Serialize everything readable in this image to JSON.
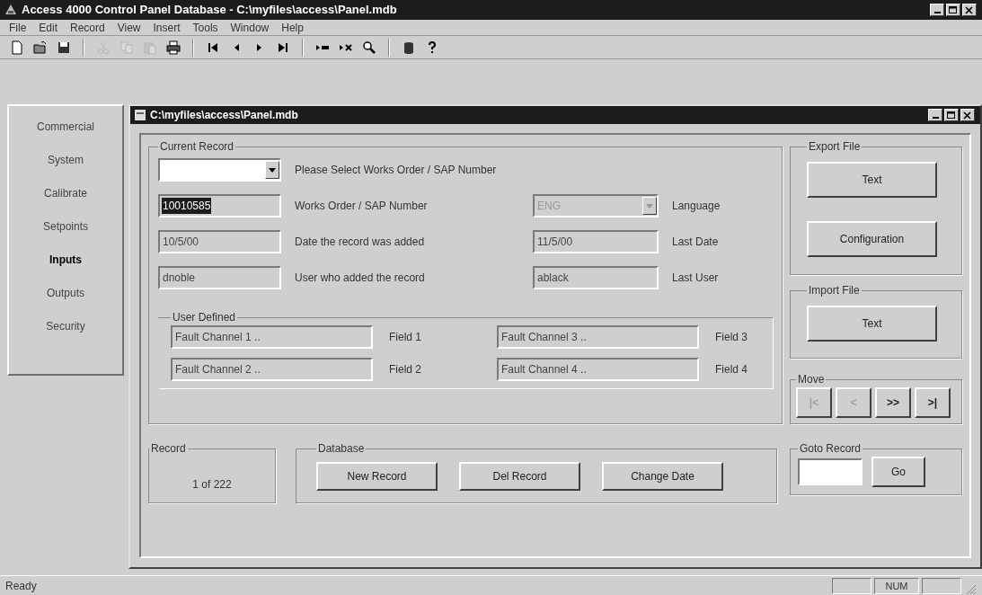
{
  "window": {
    "title": "Access 4000 Control Panel Database - C:\\myfiles\\access\\Panel.mdb"
  },
  "menu": [
    "File",
    "Edit",
    "Record",
    "View",
    "Insert",
    "Tools",
    "Window",
    "Help"
  ],
  "toolbar": [
    {
      "kind": "new",
      "disabled": false
    },
    {
      "kind": "open",
      "disabled": false
    },
    {
      "kind": "save",
      "disabled": false
    },
    {
      "kind": "separator"
    },
    {
      "kind": "cut",
      "disabled": true
    },
    {
      "kind": "copy",
      "disabled": true
    },
    {
      "kind": "paste",
      "disabled": true
    },
    {
      "kind": "print",
      "disabled": false
    },
    {
      "kind": "separator"
    },
    {
      "kind": "first",
      "disabled": false
    },
    {
      "kind": "prev",
      "disabled": false
    },
    {
      "kind": "next",
      "disabled": false
    },
    {
      "kind": "last",
      "disabled": false
    },
    {
      "kind": "separator"
    },
    {
      "kind": "new-record",
      "disabled": false
    },
    {
      "kind": "delete-record",
      "disabled": false
    },
    {
      "kind": "find",
      "disabled": false
    },
    {
      "kind": "separator"
    },
    {
      "kind": "database",
      "disabled": false
    },
    {
      "kind": "help",
      "disabled": false
    }
  ],
  "sidebar": {
    "items": [
      {
        "label": "Commercial",
        "selected": false
      },
      {
        "label": "System",
        "selected": false
      },
      {
        "label": "Calibrate",
        "selected": false
      },
      {
        "label": "Setpoints",
        "selected": false
      },
      {
        "label": "Inputs",
        "selected": true
      },
      {
        "label": "Outputs",
        "selected": false
      },
      {
        "label": "Security",
        "selected": false
      }
    ]
  },
  "document": {
    "title": "C:\\myfiles\\access\\Panel.mdb",
    "current_record": {
      "title": "Current Record",
      "selector_label": "Please Select Works Order / SAP Number",
      "rows": [
        {
          "value": "10010585",
          "highlighted": true,
          "label": "Works Order / SAP Number",
          "second": {
            "kind": "dropdown",
            "value": "ENG",
            "label": "Language"
          }
        },
        {
          "value": "10/5/00",
          "highlighted": false,
          "label": "Date the record was added",
          "second": {
            "kind": "text",
            "value": "11/5/00",
            "label": "Last Date"
          }
        },
        {
          "value": "dnoble",
          "highlighted": false,
          "label": "User who added the record",
          "second": {
            "kind": "text",
            "value": "ablack",
            "label": "Last User"
          }
        }
      ]
    },
    "user_defined": {
      "title": "User Defined",
      "rows": [
        {
          "fields": [
            {
              "text": "Fault Channel 1 ..",
              "name": "Field 1"
            },
            {
              "text": "Fault Channel 3 ..",
              "name": "Field 3"
            }
          ]
        },
        {
          "fields": [
            {
              "text": "Fault Channel 2 ..",
              "name": "Field 2"
            },
            {
              "text": "Fault Channel 4 ..",
              "name": "Field 4"
            }
          ]
        }
      ]
    },
    "record": {
      "title": "Record",
      "text": "1 of 222"
    },
    "database": {
      "title": "Database",
      "buttons": [
        "New Record",
        "Del Record",
        "Change Date"
      ]
    },
    "export_file": {
      "title": "Export File",
      "buttons": [
        "Text",
        "Configuration"
      ]
    },
    "import_file": {
      "title": "Import File",
      "buttons": [
        "Text"
      ]
    },
    "move": {
      "title": "Move",
      "buttons": [
        {
          "label": "|<",
          "disabled": true
        },
        {
          "label": "<",
          "disabled": true
        },
        {
          "label": ">>",
          "disabled": false
        },
        {
          "label": ">|",
          "disabled": false
        }
      ]
    },
    "goto_record": {
      "title": "Goto Record",
      "button": "Go"
    }
  },
  "status_bar": {
    "text": "Ready",
    "indicators": [
      "NUM"
    ]
  }
}
